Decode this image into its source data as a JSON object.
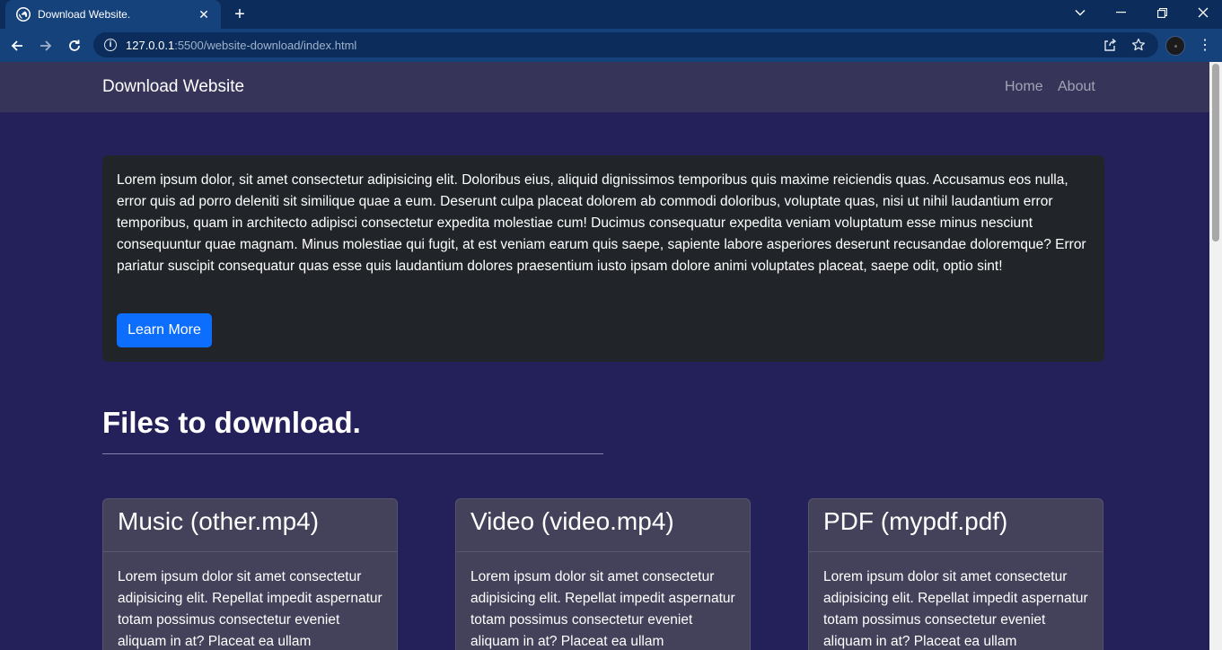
{
  "browser": {
    "tab_title": "Download Website.",
    "url_host": "127.0.0.1",
    "url_path": ":5500/website-download/index.html"
  },
  "site": {
    "brand": "Download Website",
    "nav": [
      {
        "label": "Home"
      },
      {
        "label": "About"
      }
    ]
  },
  "hero": {
    "text": "Lorem ipsum dolor, sit amet consectetur adipisicing elit. Doloribus eius, aliquid dignissimos temporibus quis maxime reiciendis quas. Accusamus eos nulla, error quis ad porro deleniti sit similique quae a eum. Deserunt culpa placeat dolorem ab commodi doloribus, voluptate quas, nisi ut nihil laudantium error temporibus, quam in architecto adipisci consectetur expedita molestiae cum! Ducimus consequatur expedita veniam voluptatum esse minus nesciunt consequuntur quae magnam. Minus molestiae qui fugit, at est veniam earum quis saepe, sapiente labore asperiores deserunt recusandae doloremque? Error pariatur suscipit consequatur quas esse quis laudantium dolores praesentium iusto ipsam dolore animi voluptates placeat, saepe odit, optio sint!",
    "button": "Learn More"
  },
  "section": {
    "title": "Files to download."
  },
  "cards": [
    {
      "title": "Music (other.mp4)",
      "body": "Lorem ipsum dolor sit amet consectetur adipisicing elit. Repellat impedit aspernatur totam possimus consectetur eveniet aliquam in at? Placeat ea ullam"
    },
    {
      "title": "Video (video.mp4)",
      "body": "Lorem ipsum dolor sit amet consectetur adipisicing elit. Repellat impedit aspernatur totam possimus consectetur eveniet aliquam in at? Placeat ea ullam"
    },
    {
      "title": "PDF (mypdf.pdf)",
      "body": "Lorem ipsum dolor sit amet consectetur adipisicing elit. Repellat impedit aspernatur totam possimus consectetur eveniet aliquam in at? Placeat ea ullam"
    }
  ],
  "colors": {
    "page_bg": "#24205a",
    "navbar_bg": "#363458",
    "hero_bg": "#212529",
    "primary": "#0d6efd",
    "card_bg": "#43425a",
    "browser_frame": "#0c2d5b",
    "browser_toolbar": "#16427c"
  }
}
